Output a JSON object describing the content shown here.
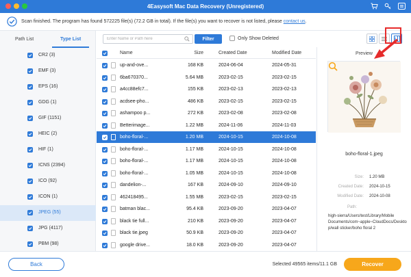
{
  "window": {
    "title": "4Easysoft Mac Data Recovery (Unregistered)"
  },
  "scan": {
    "message": "Scan finished. The program has found 572225 file(s) (72.2 GB in total). If the file(s) you want to recover is not listed, please ",
    "link": "contact us",
    "end": "."
  },
  "sidebar": {
    "tabs": [
      "Path List",
      "Type List"
    ],
    "active_tab": "Type List",
    "items": [
      {
        "label": "CR2 (3)"
      },
      {
        "label": "EMF (3)"
      },
      {
        "label": "EPS (16)"
      },
      {
        "label": "GDG (1)"
      },
      {
        "label": "GIF (1151)"
      },
      {
        "label": "HEIC (2)"
      },
      {
        "label": "HIF (1)"
      },
      {
        "label": "ICNS (2394)"
      },
      {
        "label": "ICO (92)"
      },
      {
        "label": "ICON (1)"
      },
      {
        "label": "JPEG (55)"
      },
      {
        "label": "JPG (4117)"
      },
      {
        "label": "PBM (98)"
      }
    ],
    "selected_index": 10
  },
  "toolbar": {
    "search_placeholder": "Enter Name or Path here",
    "filter_label": "Filter",
    "only_deleted_label": "Only Show Deleted"
  },
  "table": {
    "headers": {
      "name": "Name",
      "size": "Size",
      "created": "Created Date",
      "modified": "Modified Date"
    },
    "rows": [
      {
        "name": "up-and-ove...",
        "size": "168 KB",
        "created": "2024-06-04",
        "modified": "2024-05-31"
      },
      {
        "name": "6ba670370...",
        "size": "5.64 MB",
        "created": "2023-02-15",
        "modified": "2023-02-15"
      },
      {
        "name": "a4cc88efc7...",
        "size": "155 KB",
        "created": "2023-02-13",
        "modified": "2023-02-13"
      },
      {
        "name": "acdsee-pho...",
        "size": "486 KB",
        "created": "2023-02-15",
        "modified": "2023-02-15"
      },
      {
        "name": "ashampoo p...",
        "size": "272 KB",
        "created": "2023-02-08",
        "modified": "2023-02-08"
      },
      {
        "name": "Betterimage...",
        "size": "1.22 MB",
        "created": "2024-11-06",
        "modified": "2024-11-03"
      },
      {
        "name": "boho-floral-...",
        "size": "1.20 MB",
        "created": "2024-10-15",
        "modified": "2024-10-08"
      },
      {
        "name": "boho-floral-...",
        "size": "1.17 MB",
        "created": "2024-10-15",
        "modified": "2024-10-08"
      },
      {
        "name": "boho-floral-...",
        "size": "1.17 MB",
        "created": "2024-10-15",
        "modified": "2024-10-08"
      },
      {
        "name": "boho-floral-...",
        "size": "1.05 MB",
        "created": "2024-10-15",
        "modified": "2024-10-08"
      },
      {
        "name": "dandelion-...",
        "size": "167 KB",
        "created": "2024-09-10",
        "modified": "2024-09-10"
      },
      {
        "name": "462418495...",
        "size": "1.55 MB",
        "created": "2023-02-15",
        "modified": "2023-02-15"
      },
      {
        "name": "batman blac...",
        "size": "95.4 KB",
        "created": "2023-09-20",
        "modified": "2023-04-07"
      },
      {
        "name": "black tie full...",
        "size": "210 KB",
        "created": "2023-09-20",
        "modified": "2023-04-07"
      },
      {
        "name": "black tie.jpeg",
        "size": "50.9 KB",
        "created": "2023-09-20",
        "modified": "2023-04-07"
      },
      {
        "name": "google drive...",
        "size": "18.0 KB",
        "created": "2023-09-20",
        "modified": "2023-04-07"
      }
    ],
    "selected_index": 6
  },
  "preview": {
    "title": "Preview",
    "filename": "boho-floral-1.jpeg",
    "size_label": "Size:",
    "size": "1.20 MB",
    "created_label": "Created Date:",
    "created": "2024-10-15",
    "modified_label": "Modified Date:",
    "modified": "2024-10-08",
    "path_label": "Path:",
    "path": "high-sierra/Users/test/Library/Mobile Documents/com~apple~CloudDocs/Desktop/wall sticker/boho floral 2"
  },
  "footer": {
    "back_label": "Back",
    "selected_text": "Selected 49565 items/11.1 GB",
    "recover_label": "Recover"
  },
  "colors": {
    "accent": "#2e7ad8",
    "recover": "#f7a71b",
    "highlight": "#e62b2b"
  }
}
